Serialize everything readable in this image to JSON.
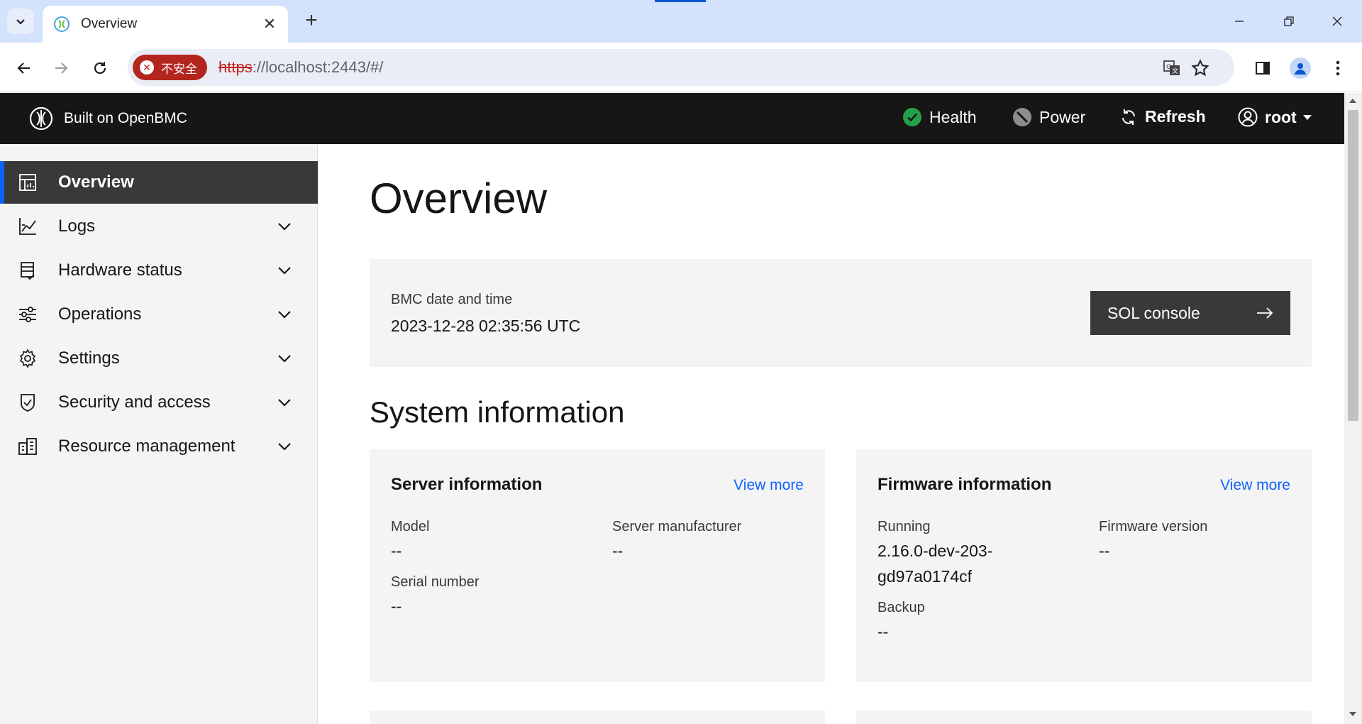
{
  "browser": {
    "tab_title": "Overview",
    "insecure_label": "不安全",
    "url_scheme": "https",
    "url_rest": "://localhost:2443/#/"
  },
  "header": {
    "brand": "Built on OpenBMC",
    "health": "Health",
    "power": "Power",
    "refresh": "Refresh",
    "user": "root",
    "health_color": "#24a148"
  },
  "sidebar": {
    "items": [
      {
        "label": "Overview",
        "icon": "dashboard-icon"
      },
      {
        "label": "Logs",
        "icon": "chart-line-icon"
      },
      {
        "label": "Hardware status",
        "icon": "server-icon"
      },
      {
        "label": "Operations",
        "icon": "sliders-icon"
      },
      {
        "label": "Settings",
        "icon": "gear-icon"
      },
      {
        "label": "Security and access",
        "icon": "shield-icon"
      },
      {
        "label": "Resource management",
        "icon": "building-icon"
      }
    ]
  },
  "main": {
    "title": "Overview",
    "bmc": {
      "label": "BMC date and time",
      "value": "2023-12-28 02:35:56 UTC",
      "sol_button": "SOL console"
    },
    "section_title": "System information",
    "server": {
      "title": "Server information",
      "view_more": "View more",
      "model_label": "Model",
      "model_value": "--",
      "manufacturer_label": "Server manufacturer",
      "manufacturer_value": "--",
      "serial_label": "Serial number",
      "serial_value": "--"
    },
    "firmware": {
      "title": "Firmware information",
      "view_more": "View more",
      "running_label": "Running",
      "running_value_1": "2.16.0-dev-203-",
      "running_value_2": "gd97a0174cf",
      "version_label": "Firmware version",
      "version_value": "--",
      "backup_label": "Backup",
      "backup_value": "--"
    }
  }
}
